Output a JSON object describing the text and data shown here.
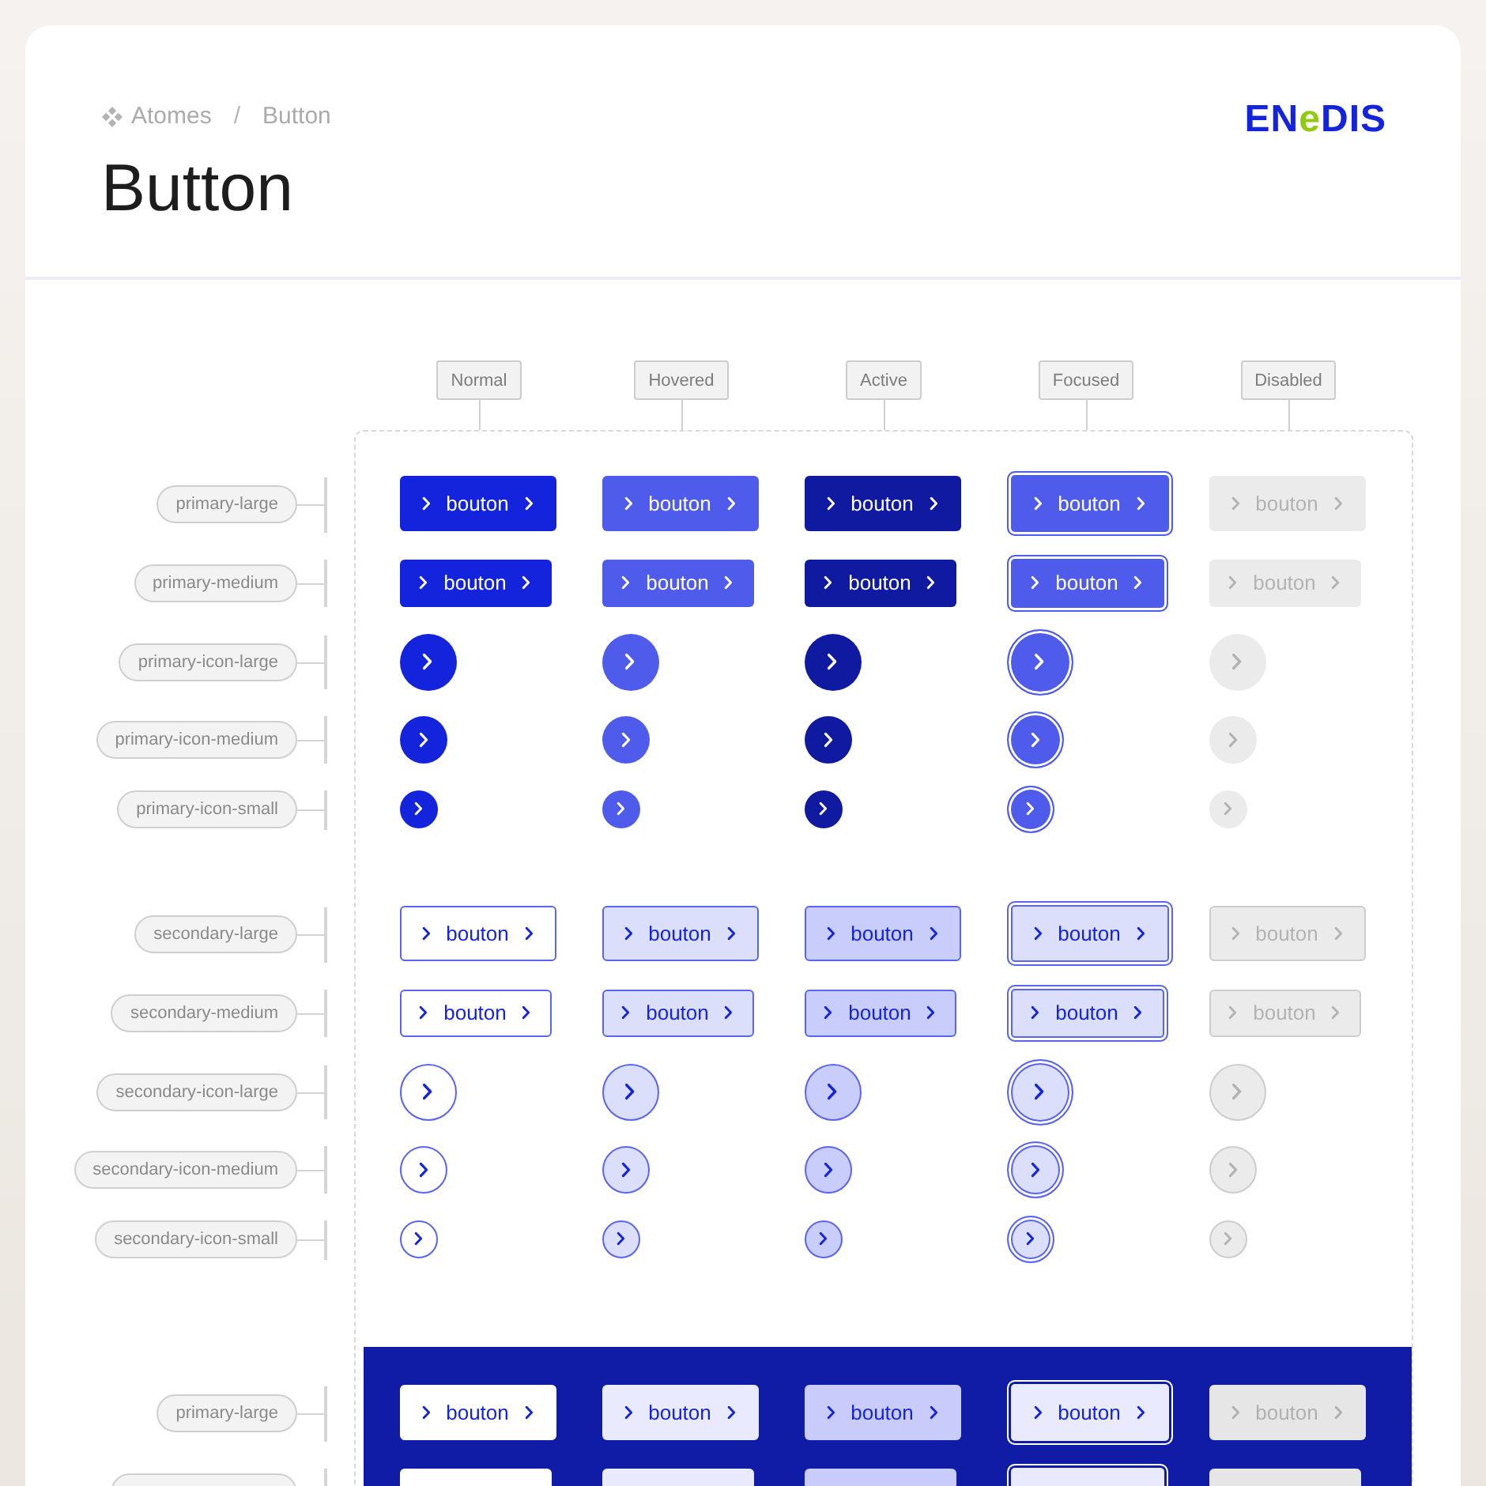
{
  "header": {
    "breadcrumb": [
      {
        "label": "Atomes"
      },
      {
        "label": "Button"
      }
    ],
    "separator": "/",
    "title": "Button",
    "logo": [
      {
        "text": "EN",
        "kind": "main"
      },
      {
        "text": "e",
        "kind": "accent"
      },
      {
        "text": "DIS",
        "kind": "main"
      }
    ]
  },
  "columns": [
    {
      "label": "Normal"
    },
    {
      "label": "Hovered"
    },
    {
      "label": "Active"
    },
    {
      "label": "Focused"
    },
    {
      "label": "Disabled"
    }
  ],
  "groups": [
    {
      "kind": "primary",
      "rows": [
        {
          "label": "primary-large",
          "kind": "large",
          "cells": [
            {
              "kind": "normal",
              "text": "bouton"
            },
            {
              "kind": "hovered",
              "text": "bouton"
            },
            {
              "kind": "active",
              "text": "bouton"
            },
            {
              "kind": "focused",
              "text": "bouton"
            },
            {
              "kind": "disabled",
              "text": "bouton"
            }
          ]
        },
        {
          "label": "primary-medium",
          "kind": "medium",
          "cells": [
            {
              "kind": "normal",
              "text": "bouton"
            },
            {
              "kind": "hovered",
              "text": "bouton"
            },
            {
              "kind": "active",
              "text": "bouton"
            },
            {
              "kind": "focused",
              "text": "bouton"
            },
            {
              "kind": "disabled",
              "text": "bouton"
            }
          ]
        },
        {
          "label": "primary-icon-large",
          "kind": "iconLarge",
          "cells": [
            {
              "kind": "normal"
            },
            {
              "kind": "hovered"
            },
            {
              "kind": "active"
            },
            {
              "kind": "focused"
            },
            {
              "kind": "disabled"
            }
          ]
        },
        {
          "label": "primary-icon-medium",
          "kind": "iconMedium",
          "cells": [
            {
              "kind": "normal"
            },
            {
              "kind": "hovered"
            },
            {
              "kind": "active"
            },
            {
              "kind": "focused"
            },
            {
              "kind": "disabled"
            }
          ]
        },
        {
          "label": "primary-icon-small",
          "kind": "iconSmall",
          "cells": [
            {
              "kind": "normal"
            },
            {
              "kind": "hovered"
            },
            {
              "kind": "active"
            },
            {
              "kind": "focused"
            },
            {
              "kind": "disabled"
            }
          ]
        }
      ]
    },
    {
      "kind": "secondary",
      "rows": [
        {
          "label": "secondary-large",
          "kind": "large",
          "cells": [
            {
              "kind": "normal",
              "text": "bouton"
            },
            {
              "kind": "hovered",
              "text": "bouton"
            },
            {
              "kind": "active",
              "text": "bouton"
            },
            {
              "kind": "focused",
              "text": "bouton"
            },
            {
              "kind": "disabled",
              "text": "bouton"
            }
          ]
        },
        {
          "label": "secondary-medium",
          "kind": "medium",
          "cells": [
            {
              "kind": "normal",
              "text": "bouton"
            },
            {
              "kind": "hovered",
              "text": "bouton"
            },
            {
              "kind": "active",
              "text": "bouton"
            },
            {
              "kind": "focused",
              "text": "bouton"
            },
            {
              "kind": "disabled",
              "text": "bouton"
            }
          ]
        },
        {
          "label": "secondary-icon-large",
          "kind": "iconLarge",
          "cells": [
            {
              "kind": "normal"
            },
            {
              "kind": "hovered"
            },
            {
              "kind": "active"
            },
            {
              "kind": "focused"
            },
            {
              "kind": "disabled"
            }
          ]
        },
        {
          "label": "secondary-icon-medium",
          "kind": "iconMedium",
          "cells": [
            {
              "kind": "normal"
            },
            {
              "kind": "hovered"
            },
            {
              "kind": "active"
            },
            {
              "kind": "focused"
            },
            {
              "kind": "disabled"
            }
          ]
        },
        {
          "label": "secondary-icon-small",
          "kind": "iconSmall",
          "cells": [
            {
              "kind": "normal"
            },
            {
              "kind": "hovered"
            },
            {
              "kind": "active"
            },
            {
              "kind": "focused"
            },
            {
              "kind": "disabled"
            }
          ]
        }
      ]
    },
    {
      "kind": "inverse",
      "rows": [
        {
          "label": "primary-large",
          "kind": "large",
          "cells": [
            {
              "kind": "normal",
              "text": "bouton"
            },
            {
              "kind": "hovered",
              "text": "bouton"
            },
            {
              "kind": "active",
              "text": "bouton"
            },
            {
              "kind": "focused",
              "text": "bouton"
            },
            {
              "kind": "disabled",
              "text": "bouton"
            }
          ]
        },
        {
          "kind": "medium",
          "cells": [
            {
              "kind": "normal"
            },
            {
              "kind": "hovered"
            },
            {
              "kind": "active"
            },
            {
              "kind": "focused"
            },
            {
              "kind": "disabled"
            }
          ]
        }
      ]
    }
  ]
}
